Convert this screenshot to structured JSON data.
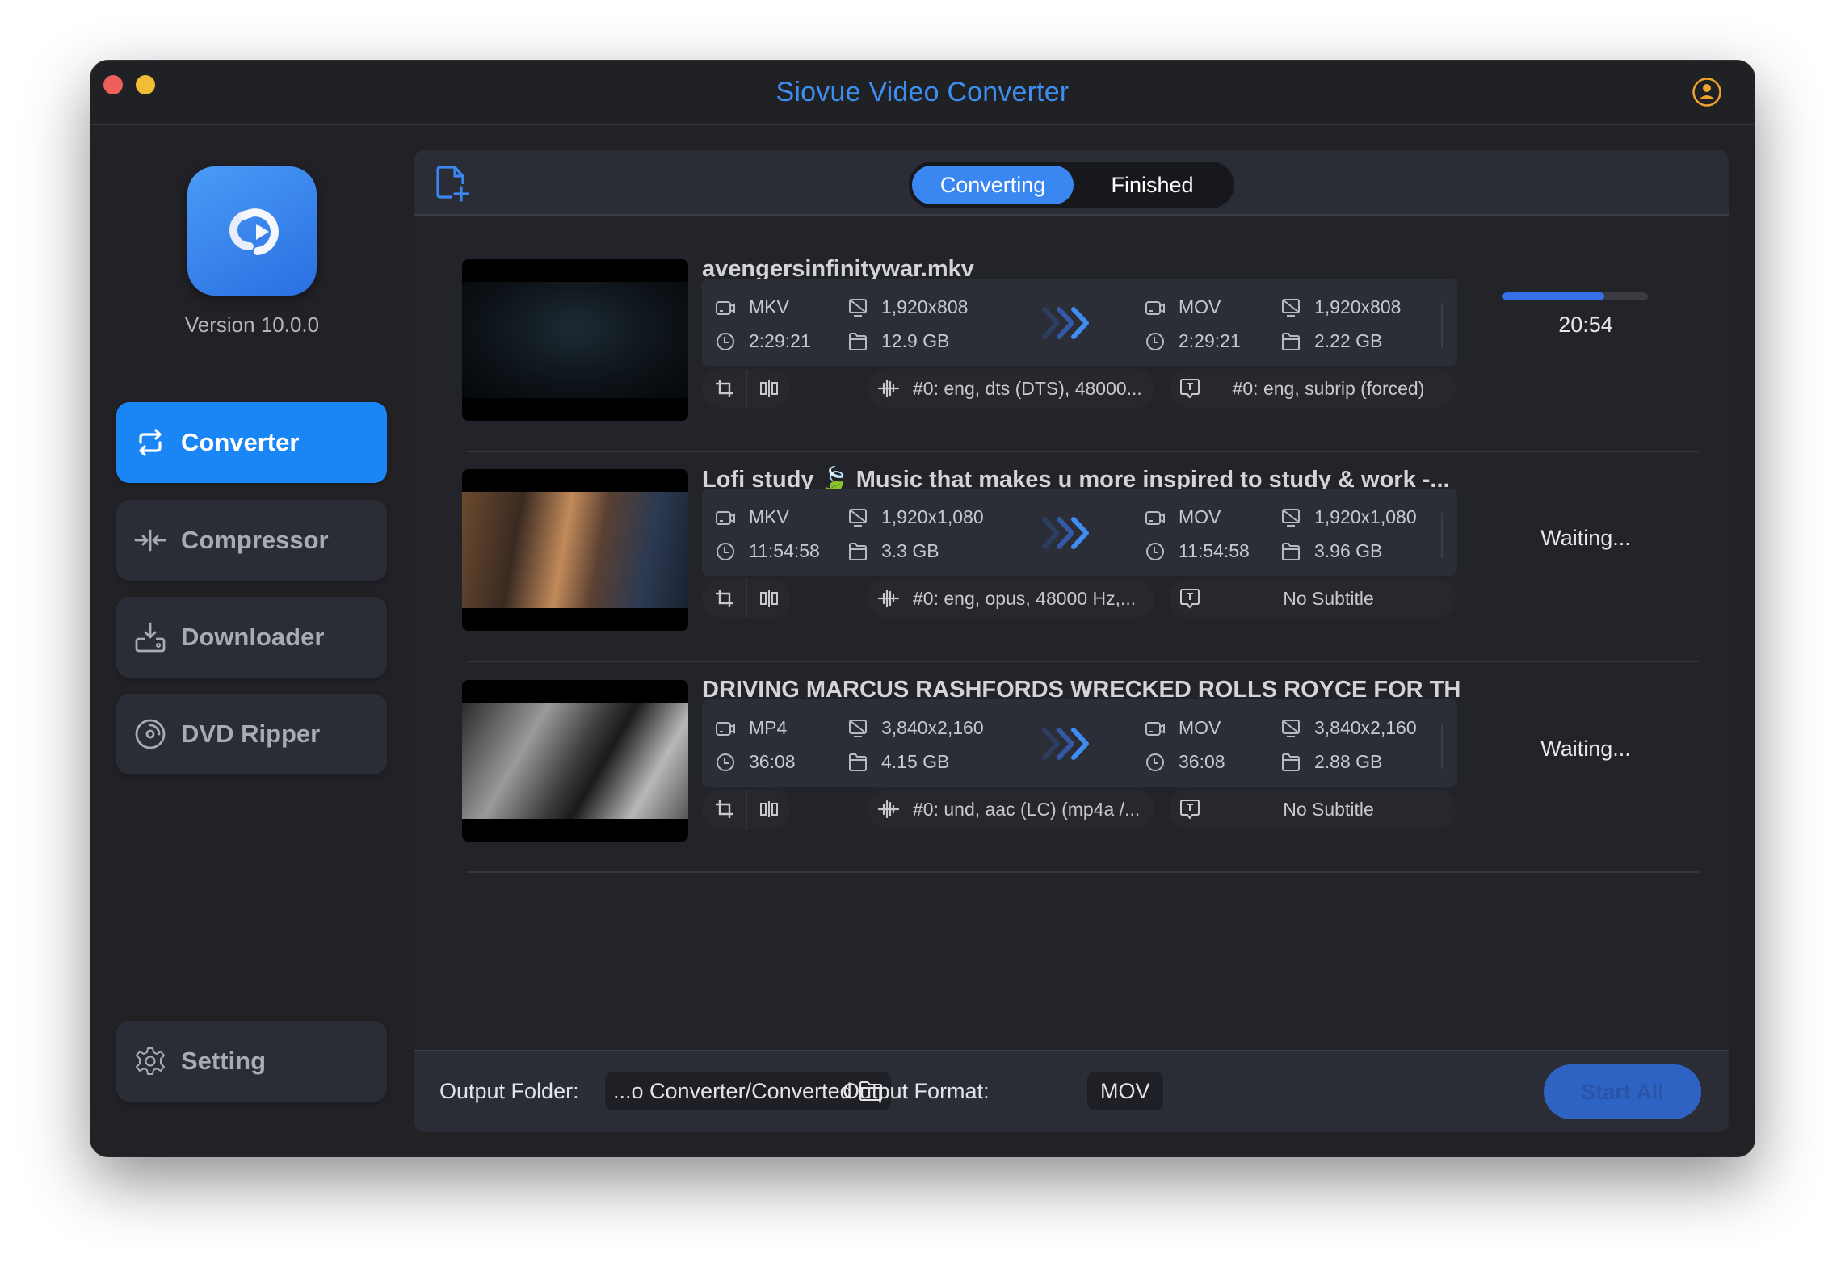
{
  "window": {
    "title": "Siovue Video Converter",
    "accent_color": "#3e8ef2"
  },
  "sidebar": {
    "version": "Version 10.0.0",
    "items": [
      {
        "label": "Converter",
        "icon": "convert-arrows-icon",
        "active": true
      },
      {
        "label": "Compressor",
        "icon": "compress-icon",
        "active": false
      },
      {
        "label": "Downloader",
        "icon": "download-icon",
        "active": false
      },
      {
        "label": "DVD Ripper",
        "icon": "disc-icon",
        "active": false
      }
    ],
    "setting_label": "Setting"
  },
  "toolbar": {
    "tabs": [
      {
        "label": "Converting",
        "active": true
      },
      {
        "label": "Finished",
        "active": false
      }
    ]
  },
  "tasks": [
    {
      "title": "avengersinfinitywar.mkv",
      "source": {
        "format": "MKV",
        "resolution": "1,920x808",
        "duration": "2:29:21",
        "size": "12.9 GB"
      },
      "target": {
        "format": "MOV",
        "resolution": "1,920x808",
        "duration": "2:29:21",
        "size": "2.22 GB"
      },
      "audio": "#0: eng, dts (DTS), 48000...",
      "subtitle": "#0: eng, subrip (forced)",
      "status": "20:54",
      "progress_percent": 70
    },
    {
      "title": "Lofi study 🍃 Music that makes u more inspired to study & work -...",
      "source": {
        "format": "MKV",
        "resolution": "1,920x1,080",
        "duration": "11:54:58",
        "size": "3.3 GB"
      },
      "target": {
        "format": "MOV",
        "resolution": "1,920x1,080",
        "duration": "11:54:58",
        "size": "3.96 GB"
      },
      "audio": "#0: eng, opus, 48000 Hz,...",
      "subtitle": "No Subtitle",
      "status": "Waiting..."
    },
    {
      "title": "DRIVING MARCUS RASHFORDS WRECKED ROLLS ROYCE FOR TH...",
      "source": {
        "format": "MP4",
        "resolution": "3,840x2,160",
        "duration": "36:08",
        "size": "4.15 GB"
      },
      "target": {
        "format": "MOV",
        "resolution": "3,840x2,160",
        "duration": "36:08",
        "size": "2.88 GB"
      },
      "audio": "#0: und, aac (LC) (mp4a /...",
      "subtitle": "No Subtitle",
      "status": "Waiting..."
    }
  ],
  "footer": {
    "output_folder_label": "Output Folder:",
    "output_folder_value": "...o Converter/Converted",
    "output_format_label": "Output Format:",
    "output_format_value": "MOV",
    "start_all_label": "Start All"
  }
}
